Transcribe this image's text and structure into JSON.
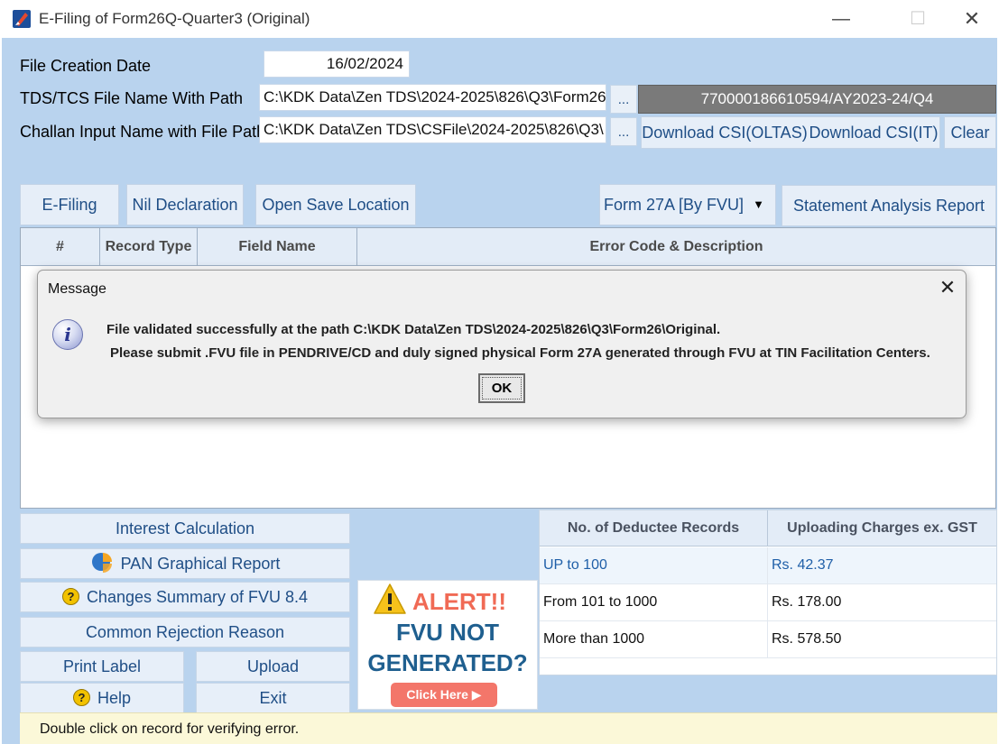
{
  "window": {
    "title": "E-Filing of Form26Q-Quarter3 (Original)",
    "minimize_glyph": "—",
    "maximize_glyph": "☐",
    "close_glyph": "✕"
  },
  "form": {
    "file_creation_date_label": "File Creation Date",
    "file_creation_date_value": "16/02/2024",
    "tds_file_label": "TDS/TCS File Name With Path",
    "tds_file_value": "C:\\KDK Data\\Zen TDS\\2024-2025\\826\\Q3\\Form26",
    "challan_label": "Challan Input Name with File Path",
    "challan_value": "C:\\KDK Data\\Zen TDS\\CSFile\\2024-2025\\826\\Q3\\",
    "browse_label": "...",
    "token_value": "770000186610594/AY2023-24/Q4"
  },
  "toolbar": {
    "download_oltas": "Download CSI(OLTAS)",
    "download_it": "Download CSI(IT)",
    "clear": "Clear",
    "efiling": "E-Filing",
    "nil_declaration": "Nil Declaration",
    "open_save_location": "Open Save Location",
    "form27a_selected": "Form 27A [By FVU]",
    "statement_analysis_report": "Statement Analysis Report"
  },
  "grid": {
    "columns": [
      "#",
      "Record Type",
      "Field Name",
      "Error Code & Description"
    ]
  },
  "dialog": {
    "title": "Message",
    "close_glyph": "✕",
    "info_glyph": "i",
    "line1": "File validated successfully at the path C:\\KDK Data\\Zen TDS\\2024-2025\\826\\Q3\\Form26\\Original.",
    "line2": "Please submit .FVU file in PENDRIVE/CD and duly signed physical Form 27A generated through FVU at TIN Facilitation Centers.",
    "ok_label": "OK"
  },
  "actions": {
    "interest_calculation": "Interest Calculation",
    "pan_graphical_report": "PAN Graphical Report",
    "changes_summary": "Changes Summary of FVU 8.4",
    "common_rejection_reason": "Common Rejection Reason",
    "print_label": "Print Label",
    "upload": "Upload",
    "help": "Help",
    "exit": "Exit",
    "question_glyph": "?"
  },
  "alert": {
    "alert_word": "ALERT!!",
    "line1": "FVU NOT",
    "line2": "GENERATED?",
    "click_here": "Click Here ▶"
  },
  "charges": {
    "headers": [
      "No. of Deductee Records",
      "Uploading Charges ex. GST"
    ],
    "rows": [
      [
        "UP to 100",
        "Rs. 42.37"
      ],
      [
        "From 101 to 1000",
        "Rs. 178.00"
      ],
      [
        "More than 1000",
        "Rs. 578.50"
      ]
    ]
  },
  "status_bar": {
    "text": "Double click on record for verifying error."
  },
  "colors": {
    "window_bg": "#b9d3ee",
    "button_text": "#1f4e86",
    "alert_red": "#f06a55",
    "fvu_blue": "#1f5f8f",
    "status_bg": "#fbf8d8"
  },
  "icons": [
    "app-logo-icon",
    "info-icon",
    "question-icon",
    "pie-chart-icon",
    "warning-icon",
    "chevron-down-icon"
  ]
}
